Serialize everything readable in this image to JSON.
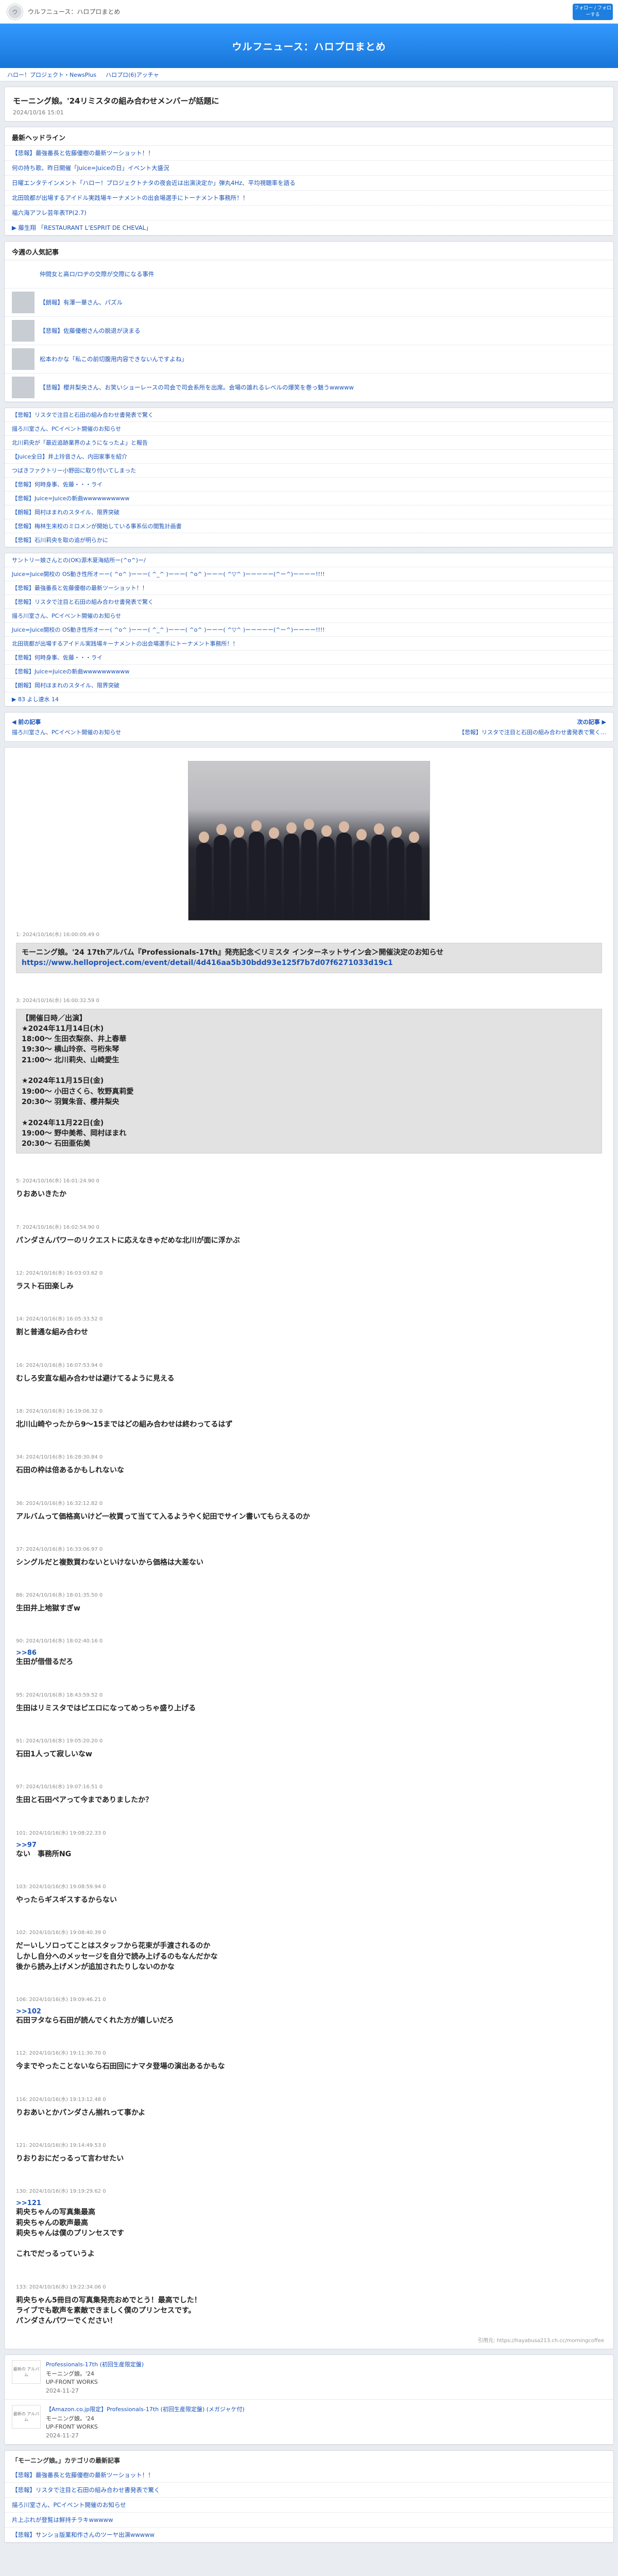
{
  "header": {
    "logo_text": "ウ",
    "site_name": "ウルフニュース：ハロプロまとめ",
    "follow_label": "フォロー / フォローする",
    "hero_title": "ウルフニュース：ハロプロまとめ"
  },
  "breadcrumbs": [
    "ハロー！プロジェクト・NewsPlus",
    "ハロプロ(6)アッチャ"
  ],
  "article": {
    "title": "モーニング娘。'24リミスタの組み合わせメンバーが話題に",
    "date": "2024/10/16 15:01"
  },
  "latest": {
    "title": "最新ヘッドライン",
    "items": [
      "【悲報】最強番長と佐藤優樹の最新ツーショット！！",
      "何の持ち歌、昨日開催「Juice=Juiceの日」イベント大盛況",
      "日曜エンタテインメント「ハロー！プロジェクトナタの夜会近は出演決定か」弾丸4Hz、平均視聴率を語る",
      "北田琉都が出場するアイドル実践場キーナメントの出会場選手にトーナメント事務所！！",
      "福六海アフレ芸年表TP(2.7)",
      "▶ 藤生翔 「RESTAURANT L'ESPRIT DE CHEVAL」"
    ]
  },
  "popular": {
    "title": "今週の人気記事",
    "items": [
      {
        "text": "仲間女と高ロ/ロヂの交際が交際になる事件",
        "thumb": false
      },
      {
        "text": "【朗報】有澤一華さん、パズル",
        "thumb": true
      },
      {
        "text": "【悲報】佐藤優樹さんの脱退が決まる",
        "thumb": true
      },
      {
        "text": "松本わかな「私この前切腹用内容できないんですよね」",
        "thumb": true
      },
      {
        "text": "【悲報】櫻井梨央さん、お笑いショーレースの司会で司会系所を出席。会場の誰れるレベルの爆笑を巻っ魅うwwwww",
        "thumb": true
      }
    ]
  },
  "related_a": [
    "【悲報】リスタで注目と石田の組み合わせ書発表で驚く",
    "描ろ川室さん、PCイベント開催のお知らせ",
    "北川莉央が「最近追跡業界のようになったよ」と報告",
    "【Juice全日】井上玲音さん、内田家事を紹介",
    "つばきファクトリー小野田に取り付いてしまった",
    "【悲報】何時身事、佐藤・・・ライ",
    "【悲報】Juice=Juiceの新曲wwwwwwwwww",
    "【朗報】岡村ほまれのスタイル、限界突破",
    "【悲報】梅林生来校のミロメンが開始している事系伝の閲覧計画書",
    "【悲報】石川莉央を取の追が明らかに"
  ],
  "related_b": [
    "サントリー娘さんとの(OK)源木夏海結所ー(^o^)ー/",
    "Juice=Juice開校の OS動き性所オーー( ^o^ )ーーー( ^_^ )ーーー( ^o^ )ーーー( ^▽^ )ーーーーー(^ー^)ーーーー!!!!",
    "【悲報】最強番長と佐藤優樹の最新ツーショット！！",
    "【悲報】リスタで注目と石田の組み合わせ書発表で驚く",
    "描ろ川室さん、PCイベント開催のお知らせ",
    "Juice=Juice開校の OS動き性所オーー( ^o^ )ーーー( ^_^ )ーーー( ^o^ )ーーー( ^▽^ )ーーーーー(^ー^)ーーーー!!!!",
    "北田琉都が出場するアイドル実践場キーナメントの出会場選手にトーナメント事務所！！",
    "【悲報】何時身事、佐藤・・・ライ",
    "【悲報】Juice=Juiceの新曲wwwwwwwwww",
    "【朗報】岡村ほまれのスタイル、限界突破",
    "▶ 83 よし速水 14"
  ],
  "prev_next": {
    "prev_label": "◀ 前の記事",
    "prev_text": "描ろ川室さん、PCイベント開催のお知らせ",
    "next_label": "次の記事 ▶",
    "next_text": "【悲報】リスタで注目と石田の組み合わせ書発表で驚く…"
  },
  "posts": [
    {
      "meta": "1: 2024/10/16(水) 16:00:09.49 0",
      "text": "モーニング娘。'24 17thアルバム『Professionals-17th』発売記念＜リミスタ インターネットサイン会＞開催決定のお知らせ",
      "url": "https://www.helloproject.com/event/detail/4d416aa5b30bdd93e125f7b7d07f6271033d19c1",
      "boxed": true,
      "anchor": ""
    },
    {
      "meta": "3: 2024/10/16(水) 16:00:32.59 0",
      "text": "【開催日時／出演】\n★2024年11月14日(木)\n18:00〜 生田衣梨奈、井上春華\n19:30〜 横山玲奈、弓桁朱琴\n21:00〜 北川莉央、山崎愛生\n\n★2024年11月15日(金)\n19:00〜 小田さくら、牧野真莉愛\n20:30〜 羽賀朱音、櫻井梨央\n\n★2024年11月22日(金)\n19:00〜 野中美希、岡村ほまれ\n20:30〜 石田亜佑美",
      "url": "",
      "boxed": true,
      "anchor": ""
    },
    {
      "meta": "5: 2024/10/16(水) 16:01:24.90 0",
      "text": "りおあいきたか",
      "url": "",
      "boxed": false,
      "anchor": ""
    },
    {
      "meta": "7: 2024/10/16(水) 16:02:54.90 0",
      "text": "パンダさんパワーのリクエストに応えなきゃだめな北川が面に浮かぶ",
      "url": "",
      "boxed": false,
      "anchor": ""
    },
    {
      "meta": "12: 2024/10/16(水) 16:03:03.62 0",
      "text": "ラスト石田楽しみ",
      "url": "",
      "boxed": false,
      "anchor": ""
    },
    {
      "meta": "14: 2024/10/16(水) 16:05:33.52 0",
      "text": "割と普通な組み合わせ",
      "url": "",
      "boxed": false,
      "anchor": ""
    },
    {
      "meta": "16: 2024/10/16(水) 16:07:53.94 0",
      "text": "むしろ安直な組み合わせは避けてるように見える",
      "url": "",
      "boxed": false,
      "anchor": ""
    },
    {
      "meta": "18: 2024/10/16(水) 16:19:06.32 0",
      "text": "北川山崎やったから9〜15まではどの組み合わせは終わってるはず",
      "url": "",
      "boxed": false,
      "anchor": ""
    },
    {
      "meta": "34: 2024/10/16(水) 16:28:30.84 0",
      "text": "石田の枠は倍あるかもしれないな",
      "url": "",
      "boxed": false,
      "anchor": ""
    },
    {
      "meta": "36: 2024/10/16(水) 16:32:12.82 0",
      "text": "アルバムって価格高いけど一枚買って当てて入るようやく妃田でサイン書いてもらえるのか",
      "url": "",
      "boxed": false,
      "anchor": ""
    },
    {
      "meta": "37: 2024/10/16(水) 16:33:06.97 0",
      "text": "シングルだと複数買わないといけないから価格は大差ない",
      "url": "",
      "boxed": false,
      "anchor": ""
    },
    {
      "meta": "86: 2024/10/16(水) 18:01:35.50 0",
      "text": "生田井上地獄すぎw",
      "url": "",
      "boxed": false,
      "anchor": ""
    },
    {
      "meta": "90: 2024/10/16(水) 18:02:40.16 0",
      "text": "生田が借借るだろ",
      "url": "",
      "boxed": false,
      "anchor": ">>86"
    },
    {
      "meta": "95: 2024/10/16(水) 18:43:59.52 0",
      "text": "生田はリミスタではピエロになってめっちゃ盛り上げる",
      "url": "",
      "boxed": false,
      "anchor": ""
    },
    {
      "meta": "91: 2024/10/16(水) 19:05:20.20 0",
      "text": "石田1人って寂しいなw",
      "url": "",
      "boxed": false,
      "anchor": ""
    },
    {
      "meta": "97: 2024/10/16(水) 19:07:16.51 0",
      "text": "生田と石田ペアって今までありましたか？",
      "url": "",
      "boxed": false,
      "anchor": ""
    },
    {
      "meta": "101: 2024/10/16(水) 19:08:22.33 0",
      "text": "ない　事務所NG",
      "url": "",
      "boxed": false,
      "anchor": ">>97"
    },
    {
      "meta": "103: 2024/10/16(水) 19:08:59.94 0",
      "text": "やったらギスギスするからない",
      "url": "",
      "boxed": false,
      "anchor": ""
    },
    {
      "meta": "102: 2024/10/16(水) 19:08:40.39 0",
      "text": "だーいしソロってことはスタッフから花束が手渡されるのか\nしかし自分へのメッセージを自分で読み上げるのもなんだかな\n後から読み上げメンが追加されたりしないのかな",
      "url": "",
      "boxed": false,
      "anchor": ""
    },
    {
      "meta": "106: 2024/10/16(水) 19:09:46.21 0",
      "text": "石田ヲタなら石田が読んでくれた方が嬉しいだろ",
      "url": "",
      "boxed": false,
      "anchor": ">>102"
    },
    {
      "meta": "112: 2024/10/16(水) 19:11:30.70 0",
      "text": "今までやったことないなら石田回にナマタ登場の演出あるかもな",
      "url": "",
      "boxed": false,
      "anchor": ""
    },
    {
      "meta": "116: 2024/10/16(水) 19:13:12.48 0",
      "text": "りおあいとかパンダさん揃れって事かよ",
      "url": "",
      "boxed": false,
      "anchor": ""
    },
    {
      "meta": "121: 2024/10/16(水) 19:14:49.53 0",
      "text": "りおりおにだっるって言わせたい",
      "url": "",
      "boxed": false,
      "anchor": ""
    },
    {
      "meta": "130: 2024/10/16(水) 19:19:29.62 0",
      "text": "莉央ちゃんの写真集最高\n莉央ちゃんの歌声最高\n莉央ちゃんは僕のプリンセスです\n\nこれでだっるっていうよ",
      "url": "",
      "boxed": false,
      "anchor": ">>121"
    },
    {
      "meta": "133: 2024/10/16(水) 19:22:34.06 0",
      "text": "莉央ちゃん5冊目の写真集発売おめでとう！最高でした！\nライブでも歌声を素敵できましく僕のプリンセスです。\nパンダさんパワーでください！",
      "url": "",
      "boxed": false,
      "anchor": ""
    }
  ],
  "source": "引用元: https://hayabusa213.ch.cc/morningcoffee",
  "ads": [
    {
      "thumb": "最新の\nアルバム",
      "title": "Professionals-17th (初回生産限定盤)",
      "sub": "モーニング娘。'24",
      "label": "UP-FRONT WORKS",
      "date": "2024-11-27"
    },
    {
      "thumb": "最新の\nアルバム",
      "title": "【Amazon.co.jp限定】Professionals-17th (初回生産限定盤) (メガジャケ付)",
      "sub": "モーニング娘。'24",
      "label": "UP-FRONT WORKS",
      "date": "2024-11-27"
    }
  ],
  "category": {
    "title": "「モーニング娘。」カテゴリの最新記事",
    "items": [
      "【悲報】最強番長と佐藤優樹の最新ツーショット！！",
      "【悲報】リスタで注目と石田の組み合わせ書発表で驚く",
      "描ろ川室さん、PCイベント開催のお知らせ",
      "片上ぶれが登覧は鮮持チラキwwwww",
      "【悲報】サンショ版業和作さんのツーヤ出演wwwww"
    ]
  }
}
